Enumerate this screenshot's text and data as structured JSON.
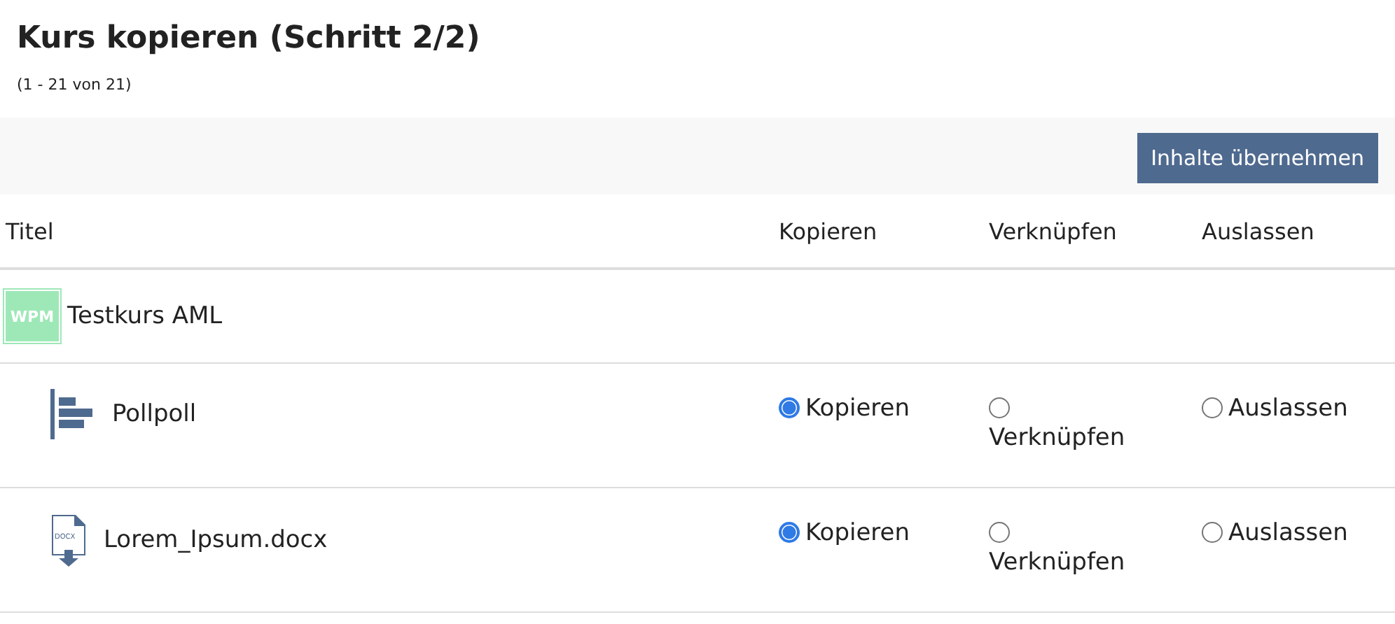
{
  "title": "Kurs kopieren (Schritt 2/2)",
  "count": "(1 - 21 von 21)",
  "toolbar": {
    "button": "Inhalte übernehmen"
  },
  "table": {
    "columns": [
      "Titel",
      "Kopieren",
      "Verknüpfen",
      "Auslassen"
    ],
    "course": {
      "badge": "WPM",
      "title": "Testkurs AML",
      "children": [
        {
          "kind": "poll",
          "title": "Pollpoll",
          "options": [
            {
              "label": "Kopieren",
              "selected": true
            },
            {
              "label": "Verknüpfen",
              "selected": false
            },
            {
              "label": "Auslassen",
              "selected": false
            }
          ]
        },
        {
          "kind": "file",
          "icon_text": "DOCX",
          "title": "Lorem_Ipsum.docx",
          "options": [
            {
              "label": "Kopieren",
              "selected": true
            },
            {
              "label": "Verknüpfen",
              "selected": false
            },
            {
              "label": "Auslassen",
              "selected": false
            }
          ]
        }
      ]
    }
  }
}
